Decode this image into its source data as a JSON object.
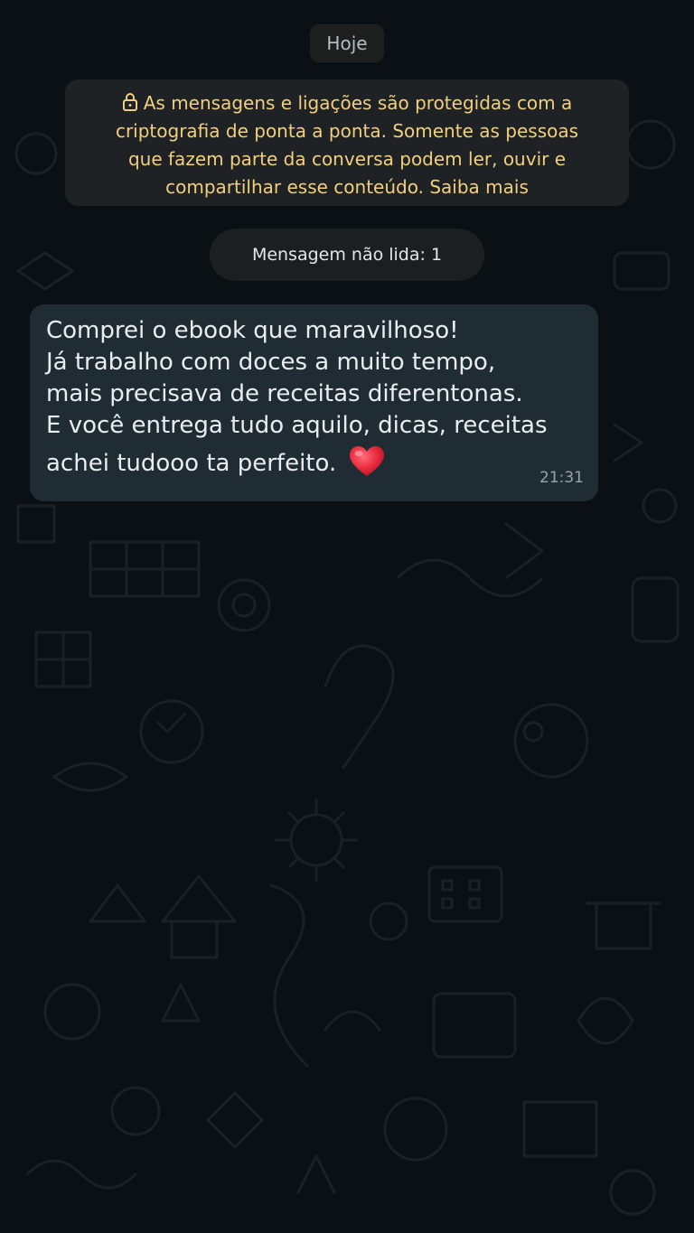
{
  "chat": {
    "date_label": "Hoje",
    "encryption_notice": "As mensagens e ligações são protegidas com a criptografia de ponta a ponta. Somente as pessoas que fazem parte da conversa podem ler, ouvir e compartilhar esse conteúdo. Saiba mais",
    "encryption_lines": [
      "As mensagens e ligações são protegidas com a",
      "criptografia de ponta a ponta. Somente as pessoas",
      "que fazem parte da conversa podem ler, ouvir e",
      "compartilhar esse conteúdo. Saiba mais"
    ],
    "unread_label": "Mensagem não lida: 1",
    "message": {
      "lines": [
        "Comprei o ebook que maravilhoso!",
        "Já trabalho com doces a muito tempo,",
        "mais precisava de receitas diferentonas.",
        "E você entrega tudo aquilo, dicas, receitas",
        "achei tudooo ta perfeito."
      ],
      "emoji": "heart-emoji",
      "time": "21:31"
    }
  },
  "colors": {
    "background": "#0b1014",
    "bubble": "#202c33",
    "notice_text": "#f2cf7d"
  }
}
